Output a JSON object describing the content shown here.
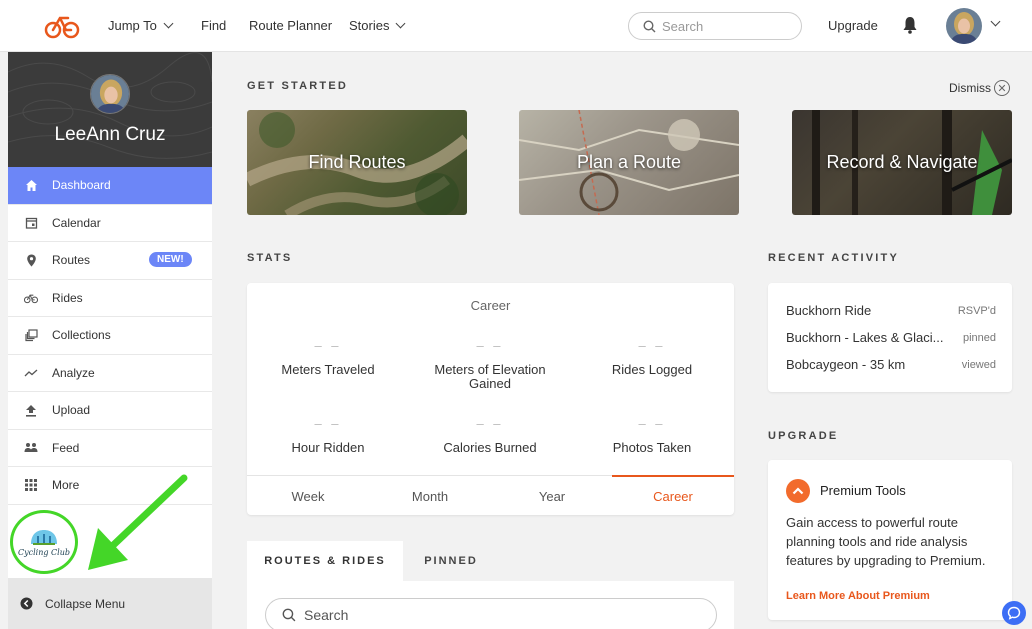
{
  "nav": {
    "jump_to": "Jump To",
    "find": "Find",
    "route_planner": "Route Planner",
    "stories": "Stories",
    "search_placeholder": "Search",
    "upgrade": "Upgrade",
    "accent": "#e8571c"
  },
  "sidebar": {
    "user_name": "LeeAnn Cruz",
    "items": [
      {
        "label": "Dashboard",
        "icon": "home-icon",
        "active": true
      },
      {
        "label": "Calendar",
        "icon": "calendar-icon"
      },
      {
        "label": "Routes",
        "icon": "map-pin-icon",
        "badge": "NEW!"
      },
      {
        "label": "Rides",
        "icon": "bike-icon"
      },
      {
        "label": "Collections",
        "icon": "collections-icon"
      },
      {
        "label": "Analyze",
        "icon": "analyze-icon"
      },
      {
        "label": "Upload",
        "icon": "upload-icon"
      },
      {
        "label": "Feed",
        "icon": "feed-icon"
      },
      {
        "label": "More",
        "icon": "grid-icon"
      }
    ],
    "club_logo_text": "Cycling Club",
    "collapse_label": "Collapse Menu",
    "active_color": "#6c86f7"
  },
  "get_started": {
    "title": "GET STARTED",
    "dismiss": "Dismiss",
    "cards": [
      "Find Routes",
      "Plan a Route",
      "Record & Navigate"
    ]
  },
  "stats": {
    "title": "STATS",
    "period_title": "Career",
    "items": [
      {
        "value": "– –",
        "label": "Meters Traveled"
      },
      {
        "value": "– –",
        "label": "Meters of Elevation Gained"
      },
      {
        "value": "– –",
        "label": "Rides Logged"
      },
      {
        "value": "– –",
        "label": "Hour Ridden"
      },
      {
        "value": "– –",
        "label": "Calories Burned"
      },
      {
        "value": "– –",
        "label": "Photos Taken"
      }
    ],
    "tabs": [
      "Week",
      "Month",
      "Year",
      "Career"
    ],
    "active_tab": "Career"
  },
  "recent": {
    "title": "RECENT ACTIVITY",
    "items": [
      {
        "title": "Buckhorn Ride",
        "status": "RSVP'd"
      },
      {
        "title": "Buckhorn - Lakes & Glaci...",
        "status": "pinned"
      },
      {
        "title": "Bobcaygeon - 35 km",
        "status": "viewed"
      }
    ]
  },
  "upgrade": {
    "title": "UPGRADE",
    "card_title": "Premium Tools",
    "description": "Gain access to powerful route planning tools and ride analysis features by upgrading to Premium.",
    "link": "Learn More About Premium"
  },
  "routes_rides": {
    "tab_active": "ROUTES & RIDES",
    "tab_pinned": "PINNED",
    "search_placeholder": "Search"
  }
}
